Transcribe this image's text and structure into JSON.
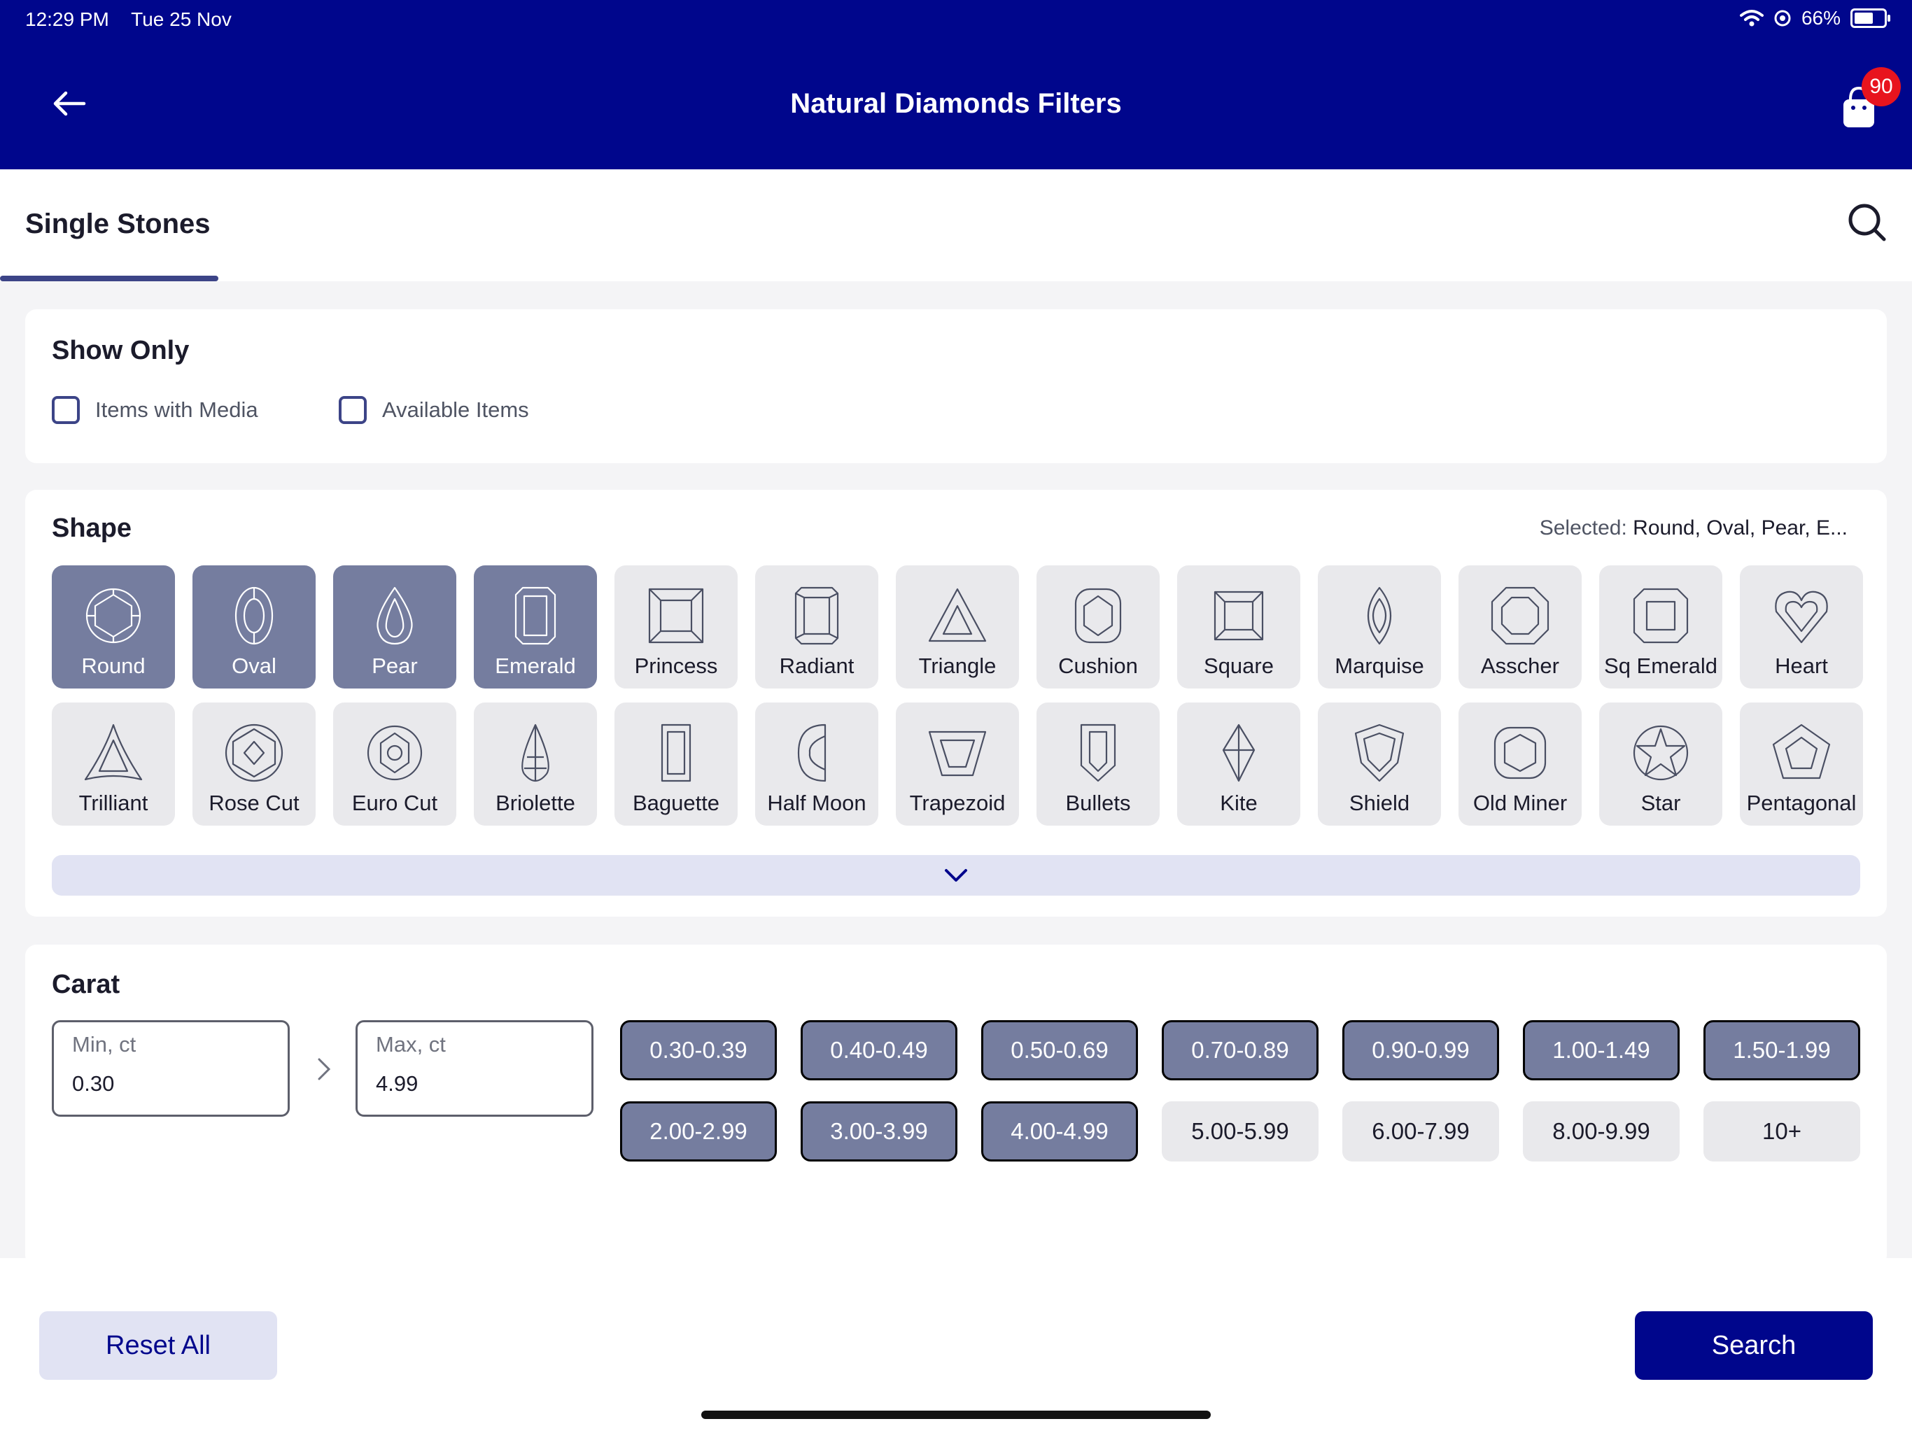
{
  "status": {
    "time": "12:29 PM",
    "date": "Tue 25 Nov",
    "battery": "66%",
    "battery_level": 0.66
  },
  "header": {
    "title": "Natural Diamonds Filters",
    "cart_count": "90"
  },
  "tabs": [
    {
      "label": "Single Stones",
      "active": true
    }
  ],
  "show_only": {
    "title": "Show Only",
    "options": [
      {
        "label": "Items with Media",
        "checked": false
      },
      {
        "label": "Available Items",
        "checked": false
      }
    ]
  },
  "shape": {
    "title": "Shape",
    "selected_label": "Selected:",
    "selected_value": "Round, Oval, Pear, E...",
    "items": [
      {
        "label": "Round",
        "selected": true,
        "icon": "round-diamond-icon"
      },
      {
        "label": "Oval",
        "selected": true,
        "icon": "oval-diamond-icon"
      },
      {
        "label": "Pear",
        "selected": true,
        "icon": "pear-diamond-icon"
      },
      {
        "label": "Emerald",
        "selected": true,
        "icon": "emerald-diamond-icon"
      },
      {
        "label": "Princess",
        "selected": false,
        "icon": "princess-diamond-icon"
      },
      {
        "label": "Radiant",
        "selected": false,
        "icon": "radiant-diamond-icon"
      },
      {
        "label": "Triangle",
        "selected": false,
        "icon": "triangle-diamond-icon"
      },
      {
        "label": "Cushion",
        "selected": false,
        "icon": "cushion-diamond-icon"
      },
      {
        "label": "Square",
        "selected": false,
        "icon": "square-diamond-icon"
      },
      {
        "label": "Marquise",
        "selected": false,
        "icon": "marquise-diamond-icon"
      },
      {
        "label": "Asscher",
        "selected": false,
        "icon": "asscher-diamond-icon"
      },
      {
        "label": "Sq Emerald",
        "selected": false,
        "icon": "sq-emerald-diamond-icon"
      },
      {
        "label": "Heart",
        "selected": false,
        "icon": "heart-diamond-icon"
      },
      {
        "label": "Trilliant",
        "selected": false,
        "icon": "trilliant-diamond-icon"
      },
      {
        "label": "Rose Cut",
        "selected": false,
        "icon": "rose-cut-diamond-icon"
      },
      {
        "label": "Euro Cut",
        "selected": false,
        "icon": "euro-cut-diamond-icon"
      },
      {
        "label": "Briolette",
        "selected": false,
        "icon": "briolette-diamond-icon"
      },
      {
        "label": "Baguette",
        "selected": false,
        "icon": "baguette-diamond-icon"
      },
      {
        "label": "Half Moon",
        "selected": false,
        "icon": "half-moon-diamond-icon"
      },
      {
        "label": "Trapezoid",
        "selected": false,
        "icon": "trapezoid-diamond-icon"
      },
      {
        "label": "Bullets",
        "selected": false,
        "icon": "bullets-diamond-icon"
      },
      {
        "label": "Kite",
        "selected": false,
        "icon": "kite-diamond-icon"
      },
      {
        "label": "Shield",
        "selected": false,
        "icon": "shield-diamond-icon"
      },
      {
        "label": "Old Miner",
        "selected": false,
        "icon": "old-miner-diamond-icon"
      },
      {
        "label": "Star",
        "selected": false,
        "icon": "star-diamond-icon"
      },
      {
        "label": "Pentagonal",
        "selected": false,
        "icon": "pentagonal-diamond-icon"
      }
    ]
  },
  "carat": {
    "title": "Carat",
    "min": {
      "label": "Min, ct",
      "value": "0.30"
    },
    "max": {
      "label": "Max, ct",
      "value": "4.99"
    },
    "ranges": [
      {
        "label": "0.30-0.39",
        "selected": true
      },
      {
        "label": "0.40-0.49",
        "selected": true
      },
      {
        "label": "0.50-0.69",
        "selected": true
      },
      {
        "label": "0.70-0.89",
        "selected": true
      },
      {
        "label": "0.90-0.99",
        "selected": true
      },
      {
        "label": "1.00-1.49",
        "selected": true
      },
      {
        "label": "1.50-1.99",
        "selected": true
      },
      {
        "label": "2.00-2.99",
        "selected": true
      },
      {
        "label": "3.00-3.99",
        "selected": true
      },
      {
        "label": "4.00-4.99",
        "selected": true
      },
      {
        "label": "5.00-5.99",
        "selected": false
      },
      {
        "label": "6.00-7.99",
        "selected": false
      },
      {
        "label": "8.00-9.99",
        "selected": false
      },
      {
        "label": "10+",
        "selected": false
      }
    ]
  },
  "footer": {
    "reset_label": "Reset All",
    "search_label": "Search"
  },
  "colors": {
    "primary": "#00068c",
    "chip_selected": "#757d9f",
    "badge": "#e8141e",
    "tile_bg": "#e9e9ec",
    "accent_light": "#e1e3f3"
  }
}
